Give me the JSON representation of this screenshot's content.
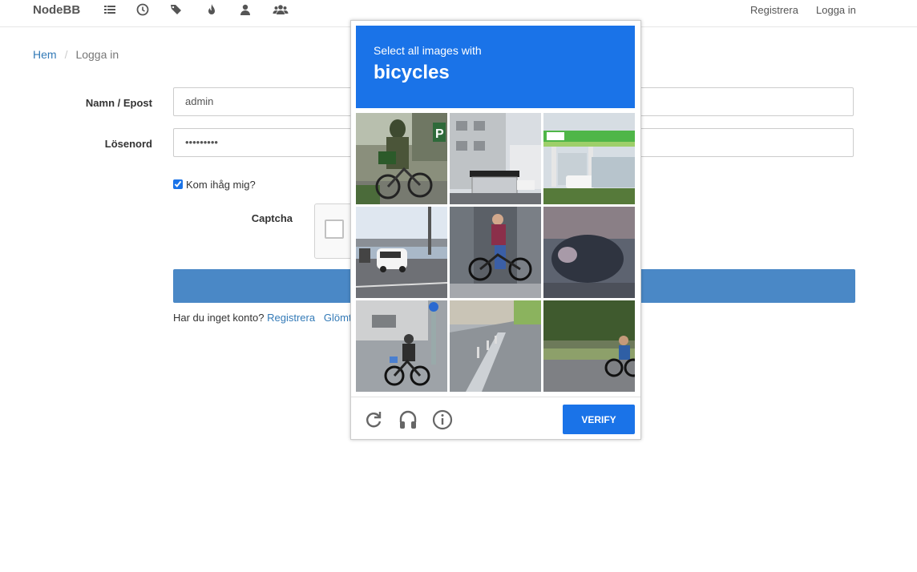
{
  "navbar": {
    "brand": "NodeBB",
    "icons": [
      "list-icon",
      "clock-icon",
      "tags-icon",
      "fire-icon",
      "user-icon",
      "users-icon"
    ],
    "register": "Registrera",
    "login": "Logga in"
  },
  "breadcrumb": {
    "home": "Hem",
    "separator": "/",
    "current": "Logga in"
  },
  "form": {
    "username_label": "Namn / Epost",
    "username_value": "admin",
    "password_label": "Lösenord",
    "password_value": "•••••••••",
    "remember_label": "Kom ihåg mig?",
    "remember_checked": true,
    "captcha_label": "Captcha",
    "no_account": "Har du inget konto?",
    "register_link": "Registrera",
    "forgot_link": "Glömt l"
  },
  "recaptcha": {
    "instruction": "Select all images with",
    "target": "bicycles",
    "verify": "VERIFY",
    "header_color": "#1a73e8",
    "footer_icons": [
      "reload-icon",
      "audio-icon",
      "info-icon"
    ],
    "tiles": [
      "tile-1",
      "tile-2",
      "tile-3",
      "tile-4",
      "tile-5",
      "tile-6",
      "tile-7",
      "tile-8",
      "tile-9"
    ]
  }
}
